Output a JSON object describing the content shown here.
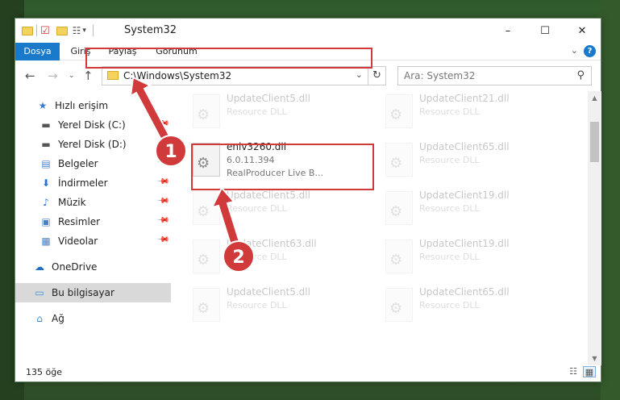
{
  "window": {
    "title": "System32",
    "controls": {
      "minimize": "–",
      "maximize": "☐",
      "close": "✕"
    }
  },
  "ribbon": {
    "tabs": [
      {
        "label": "Dosya"
      },
      {
        "label": "Giriş"
      },
      {
        "label": "Paylaş"
      },
      {
        "label": "Görünüm"
      }
    ],
    "help": "?"
  },
  "navbar": {
    "address": "C:\\Windows\\System32",
    "search_placeholder": "Ara: System32"
  },
  "sidebar": {
    "items": [
      {
        "label": "Hızlı erişim",
        "icon": "star-icon",
        "glyph": "★",
        "pinned": false
      },
      {
        "label": "Yerel Disk (C:)",
        "icon": "drive-icon",
        "glyph": "▬",
        "pinned": true
      },
      {
        "label": "Yerel Disk (D:)",
        "icon": "drive-icon",
        "glyph": "▬",
        "pinned": true
      },
      {
        "label": "Belgeler",
        "icon": "documents-icon",
        "glyph": "▤",
        "pinned": true
      },
      {
        "label": "İndirmeler",
        "icon": "download-icon",
        "glyph": "⬇",
        "pinned": true
      },
      {
        "label": "Müzik",
        "icon": "music-icon",
        "glyph": "♪",
        "pinned": true
      },
      {
        "label": "Resimler",
        "icon": "pictures-icon",
        "glyph": "▣",
        "pinned": true
      },
      {
        "label": "Videolar",
        "icon": "videos-icon",
        "glyph": "▦",
        "pinned": true
      },
      {
        "label": "OneDrive",
        "icon": "cloud-icon",
        "glyph": "☁",
        "pinned": false
      },
      {
        "label": "Bu bilgisayar",
        "icon": "computer-icon",
        "glyph": "▭",
        "pinned": false,
        "selected": true
      },
      {
        "label": "Ağ",
        "icon": "network-icon",
        "glyph": "⌂",
        "pinned": false
      }
    ]
  },
  "content": {
    "highlighted_file": {
      "name": "enlv3260.dll",
      "version": "6.0.11.394",
      "description": "RealProducer Live B..."
    },
    "files_col1": [
      {
        "name": "UpdateClient5.dll",
        "type": "Resource DLL"
      },
      {
        "name": "UpdateClient5.dll",
        "type": "Resource DLL"
      },
      {
        "name": "UpdateClient63.dll",
        "type": "Resource DLL"
      },
      {
        "name": "UpdateClient5.dll",
        "type": "Resource DLL"
      }
    ],
    "files_col2": [
      {
        "name": "UpdateClient21.dll",
        "type": "Resource DLL"
      },
      {
        "name": "UpdateClient65.dll",
        "type": "Resource DLL"
      },
      {
        "name": "UpdateClient19.dll",
        "type": "Resource DLL"
      },
      {
        "name": "UpdateClient19.dll",
        "type": "Resource DLL"
      },
      {
        "name": "UpdateClient65.dll",
        "type": "Resource DLL"
      }
    ]
  },
  "status": {
    "count": "135 öğe"
  },
  "annotations": {
    "step1": "1",
    "step2": "2",
    "color": "#d03a3a"
  }
}
